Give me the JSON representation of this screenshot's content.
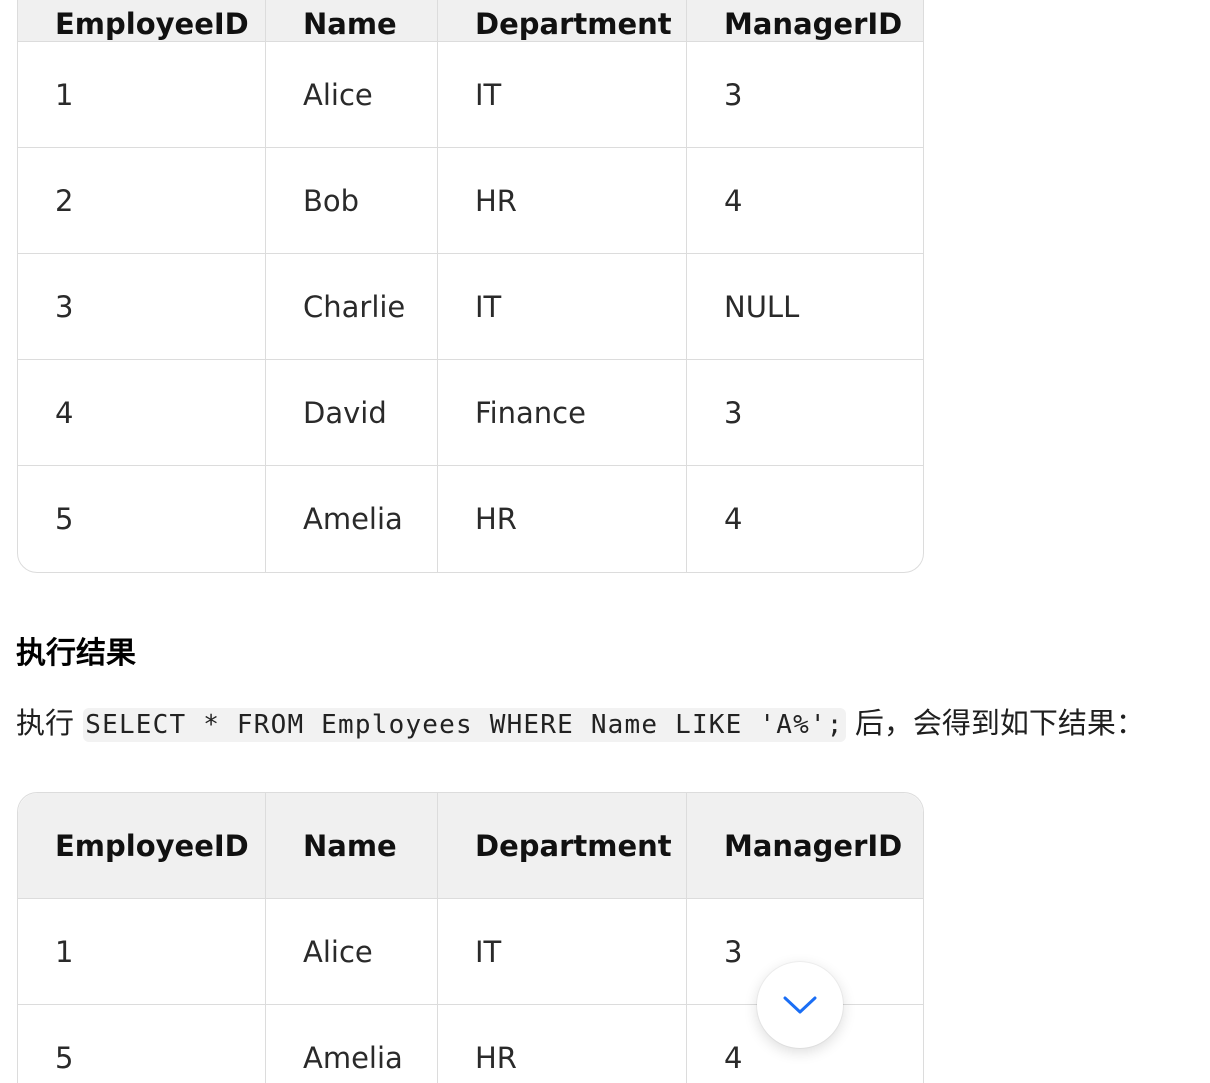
{
  "table1": {
    "headers": [
      "EmployeeID",
      "Name",
      "Department",
      "ManagerID"
    ],
    "rows": [
      [
        "1",
        "Alice",
        "IT",
        "3"
      ],
      [
        "2",
        "Bob",
        "HR",
        "4"
      ],
      [
        "3",
        "Charlie",
        "IT",
        "NULL"
      ],
      [
        "4",
        "David",
        "Finance",
        "3"
      ],
      [
        "5",
        "Amelia",
        "HR",
        "4"
      ]
    ]
  },
  "result_section": {
    "heading": "执行结果",
    "text_before": "执行",
    "code": "SELECT * FROM Employees WHERE Name LIKE 'A%';",
    "text_after": "后，会得到如下结果："
  },
  "table2": {
    "headers": [
      "EmployeeID",
      "Name",
      "Department",
      "ManagerID"
    ],
    "rows": [
      [
        "1",
        "Alice",
        "IT",
        "3"
      ],
      [
        "5",
        "Amelia",
        "HR",
        "4"
      ]
    ]
  },
  "scroll_button": {
    "icon": "chevron-down-icon",
    "color": "#1a6ef5"
  }
}
